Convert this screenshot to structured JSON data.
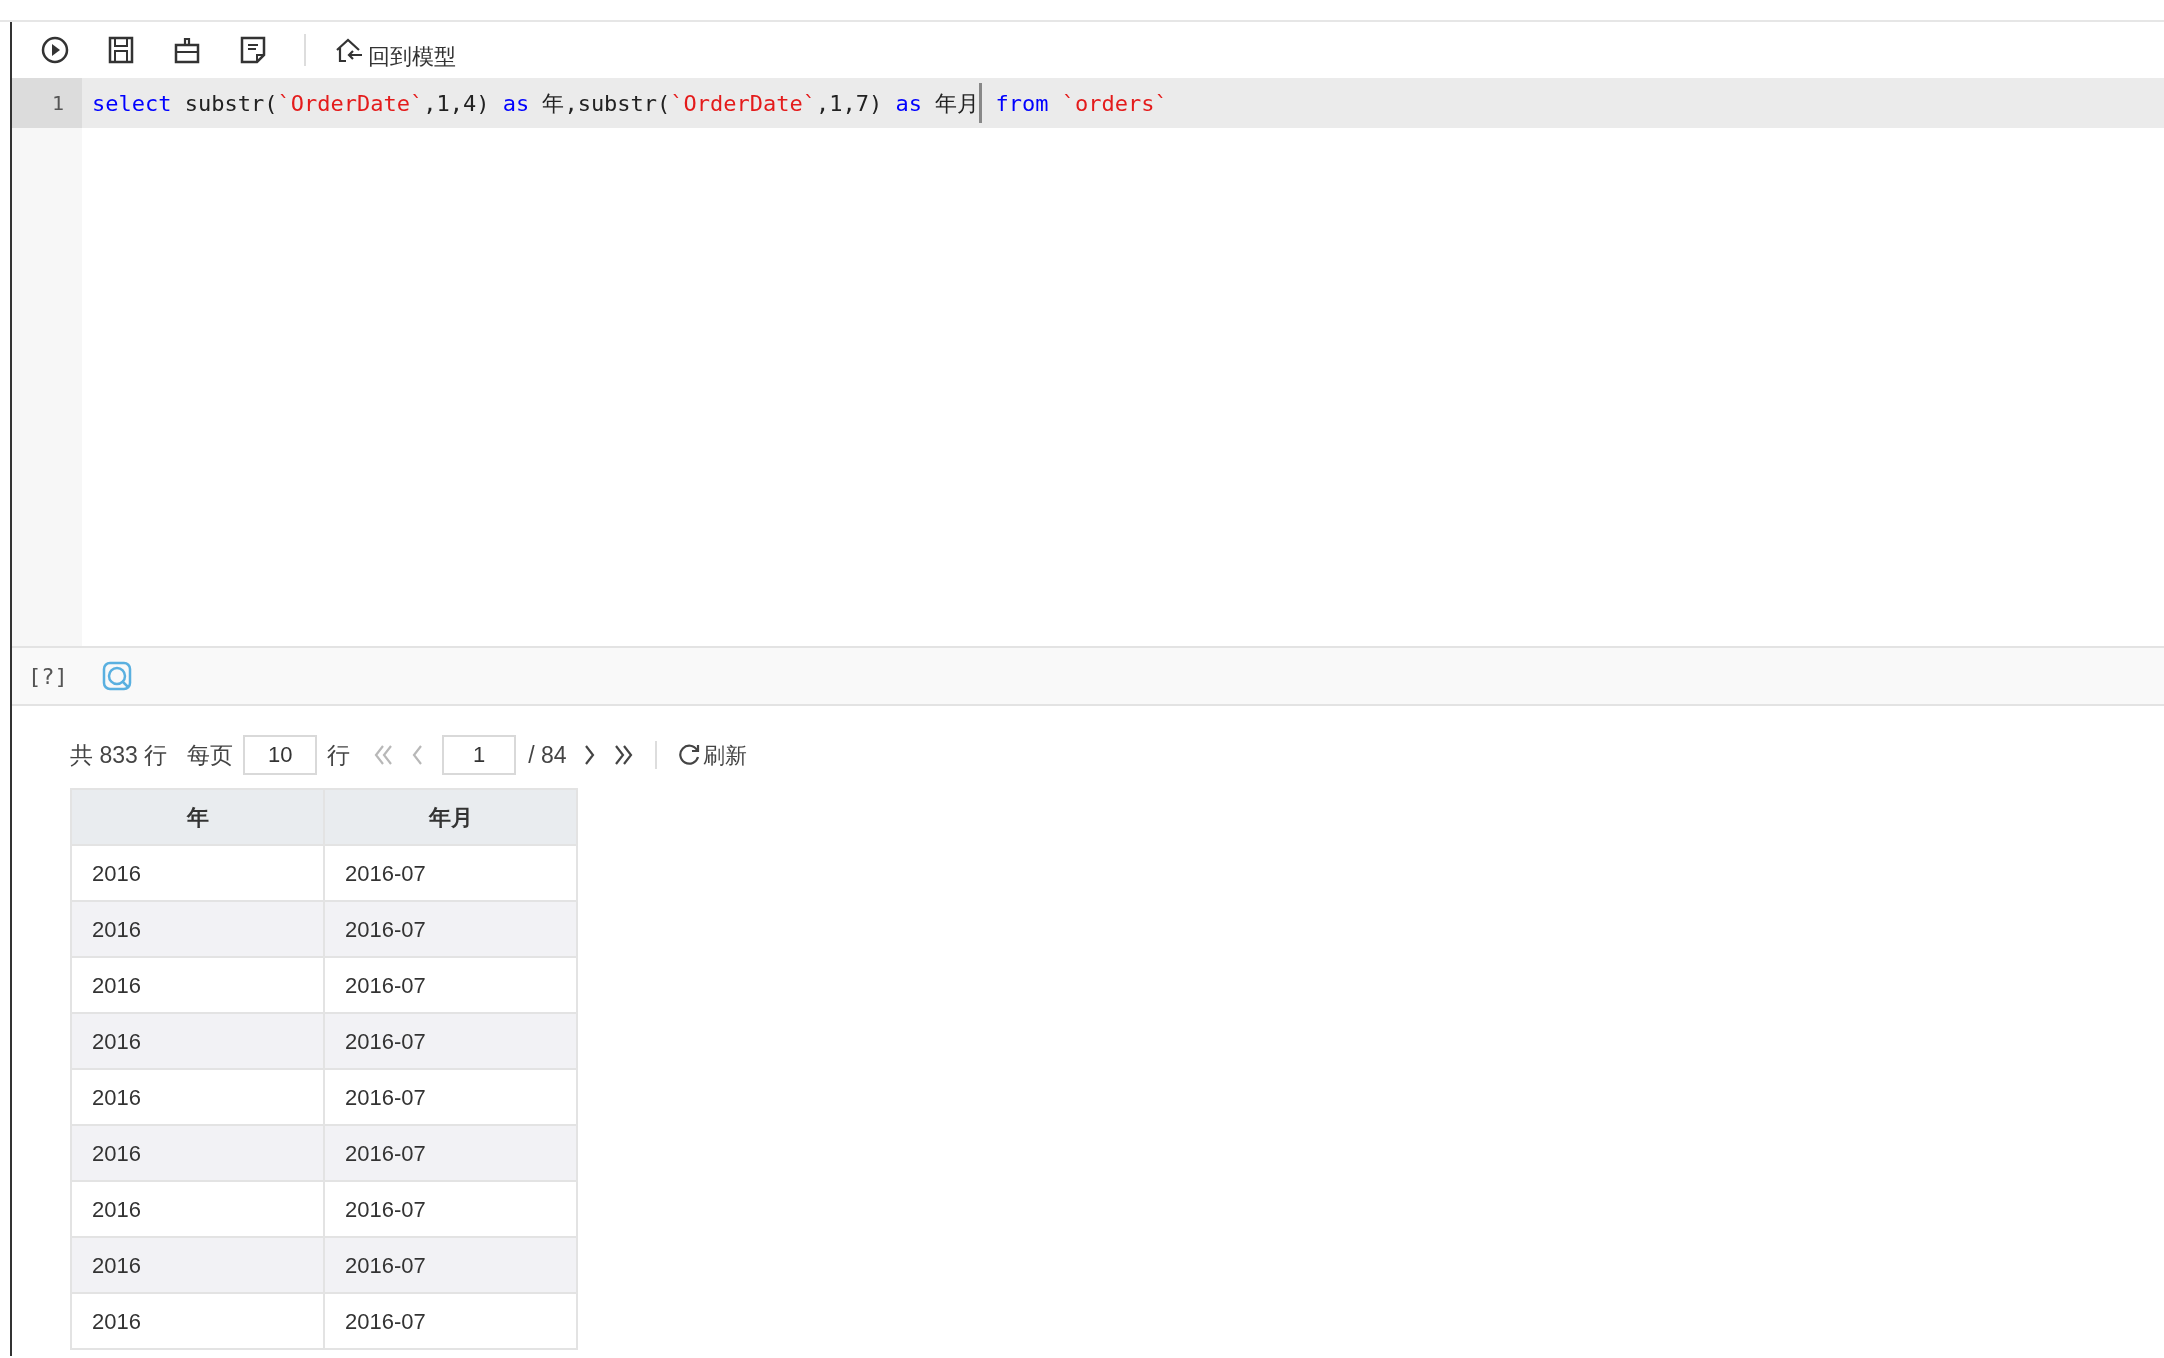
{
  "toolbar": {
    "items": [
      {
        "kind": "run"
      },
      {
        "kind": "save"
      },
      {
        "kind": "export"
      },
      {
        "kind": "sql"
      },
      {
        "kind": "separator"
      },
      {
        "kind": "home",
        "label": "回到模型"
      }
    ]
  },
  "editor": {
    "lines": [
      {
        "number": "1",
        "current": true,
        "tokens": [
          {
            "kind": "keyword",
            "text": "select"
          },
          {
            "kind": "plain",
            "text": " substr("
          },
          {
            "kind": "string",
            "text": "`OrderDate`"
          },
          {
            "kind": "plain",
            "text": ",1,4) "
          },
          {
            "kind": "keyword",
            "text": "as"
          },
          {
            "kind": "plain",
            "text": " 年,substr("
          },
          {
            "kind": "string",
            "text": "`OrderDate`"
          },
          {
            "kind": "plain",
            "text": ",1,7) "
          },
          {
            "kind": "keyword",
            "text": "as"
          },
          {
            "kind": "plain",
            "text": " 年月"
          },
          {
            "kind": "cursor"
          },
          {
            "kind": "keyword",
            "text": " from"
          },
          {
            "kind": "string",
            "text": " `orders`"
          }
        ]
      }
    ]
  },
  "result_toolbar": {
    "help": "[?]"
  },
  "pagination": {
    "total": "共 833 行",
    "per_page_label": "每页",
    "per_page": "10",
    "rows_unit": "行",
    "page": "1",
    "page_count": "/ 84",
    "nav": [
      {
        "kind": "first",
        "disabled": true
      },
      {
        "kind": "prev",
        "disabled": true
      },
      {
        "kind": "page"
      },
      {
        "kind": "next",
        "disabled": false
      },
      {
        "kind": "last",
        "disabled": false
      }
    ],
    "refresh": "刷新"
  },
  "table": {
    "columns": [
      "年",
      "年月"
    ],
    "rows": [
      [
        "2016",
        "2016-07"
      ],
      [
        "2016",
        "2016-07"
      ],
      [
        "2016",
        "2016-07"
      ],
      [
        "2016",
        "2016-07"
      ],
      [
        "2016",
        "2016-07"
      ],
      [
        "2016",
        "2016-07"
      ],
      [
        "2016",
        "2016-07"
      ],
      [
        "2016",
        "2016-07"
      ],
      [
        "2016",
        "2016-07"
      ]
    ]
  }
}
